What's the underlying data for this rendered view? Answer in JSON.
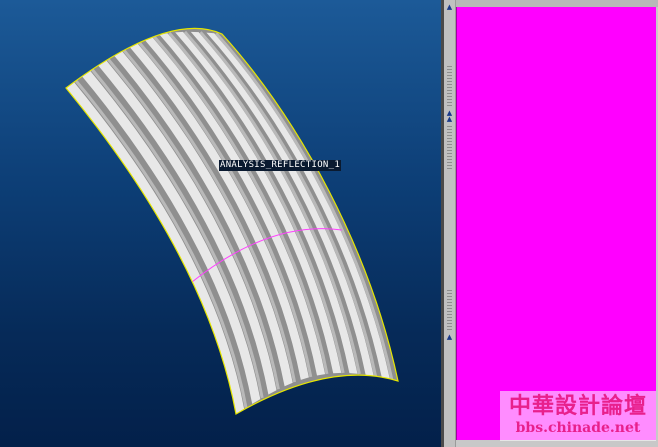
{
  "viewport": {
    "model_tag": "ANALYSIS_REFLECTION_1",
    "stripe_count": 10,
    "colors": {
      "surface_light": "#e8e8e8",
      "surface_dark": "#8f8f8f",
      "boundary_edge": "#e6e600",
      "section_curve": "#ff40ff",
      "background_top": "#1c5a98",
      "background_bottom": "#03204a"
    }
  },
  "side_panel": {
    "color": "#ff00ff",
    "strip_markers": [
      "arrow-up-icon",
      "arrow-up-icon",
      "arrow-up-icon",
      "arrow-up-icon"
    ]
  },
  "watermark": {
    "title": "中華設計論壇",
    "url": "bbs.chinade.net"
  }
}
